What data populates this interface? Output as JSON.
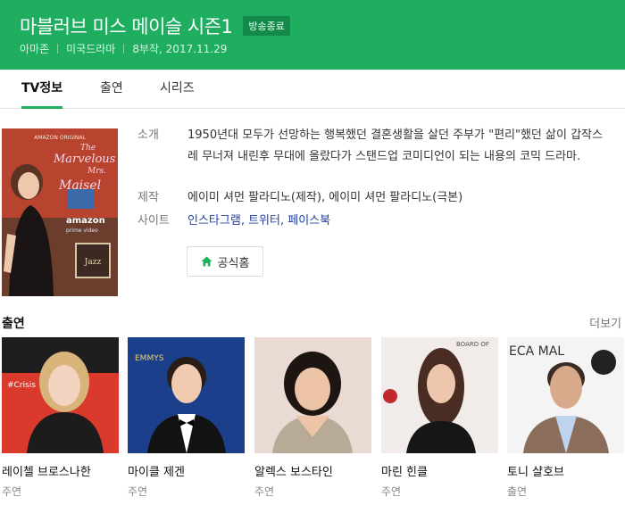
{
  "header": {
    "title": "마블러브 미스 메이슬 시즌1",
    "badge": "방송종료",
    "meta": [
      "아마존",
      "미국드라마",
      "8부작, 2017.11.29"
    ]
  },
  "tabs": [
    {
      "label": "TV정보",
      "active": true
    },
    {
      "label": "출연",
      "active": false
    },
    {
      "label": "시리즈",
      "active": false
    }
  ],
  "poster": {
    "brand_top": "AMAZON ORIGINAL",
    "logo_lines": [
      "The",
      "Marvelous",
      "Mrs.",
      "Maisel"
    ],
    "amazon": "amazon",
    "prime": "prime video",
    "sign1": "Jazz"
  },
  "info": {
    "intro_label": "소개",
    "intro_text": "1950년대 모두가 선망하는 행복했던 결혼생활을 살던 주부가 \"편리\"했던 삶이 갑작스레 무너져 내린후 무대에 올랐다가 스탠드업 코미디언이 되는 내용의 코믹 드라마.",
    "production_label": "제작",
    "production_text": "에이미 셔먼 팔라디노(제작), 에이미 셔먼 팔라디노(극본)",
    "site_label": "사이트",
    "sites": [
      "인스타그램",
      "트위터",
      "페이스북"
    ],
    "site_sep": ", ",
    "home_button": "공식홈"
  },
  "cast_section": {
    "title": "출연",
    "more": "더보기"
  },
  "cast": [
    {
      "name": "레이첼 브로스나한",
      "role": "주연",
      "photo_text": "#Crisis"
    },
    {
      "name": "마이클 제겐",
      "role": "주연",
      "photo_text": "EMMYS"
    },
    {
      "name": "알렉스 보스타인",
      "role": "주연",
      "photo_text": ""
    },
    {
      "name": "마린 힌클",
      "role": "주연",
      "photo_text": "BOARD OF"
    },
    {
      "name": "토니 샬호브",
      "role": "출연",
      "photo_text": "ECA MAL"
    }
  ],
  "colors": {
    "brand_green": "#1fae60",
    "badge_bg": "#138a49",
    "link_blue": "#1f3fa8"
  },
  "icons": {
    "home": "home-icon"
  }
}
